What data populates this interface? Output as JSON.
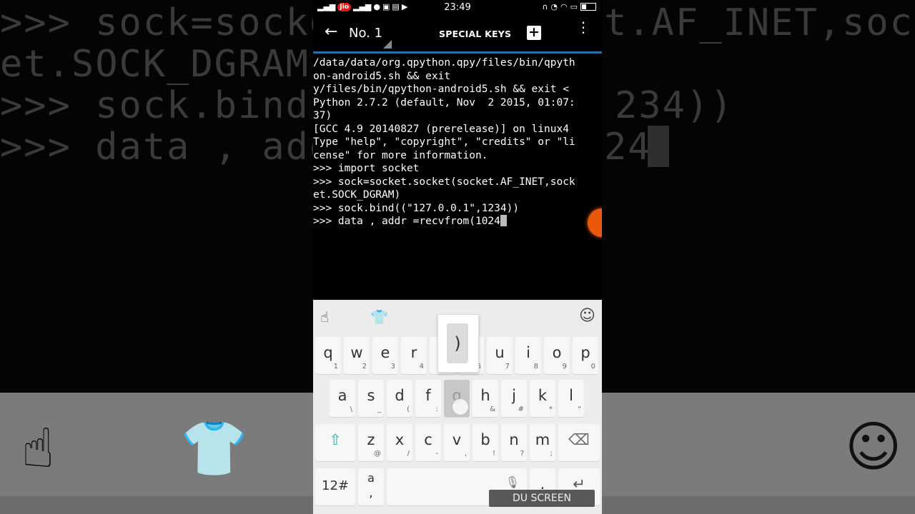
{
  "background": {
    "lines": [
      ">>> sock=socket",
      "et.SOCK_DGRAM)",
      ">>> sock.bind((",
      ">>> data , addr"
    ],
    "lines_right": [
      "t.AF_INET,sock",
      "",
      "234))",
      "24"
    ]
  },
  "status_bar": {
    "carrier": "Jio",
    "time": "23:49"
  },
  "app_bar": {
    "title": "No. 1",
    "special_keys": "SPECIAL KEYS"
  },
  "terminal": {
    "lines": [
      "/data/data/org.qpython.qpy/files/bin/qpyth",
      "on-android5.sh && exit",
      "y/files/bin/qpython-android5.sh && exit <",
      "Python 2.7.2 (default, Nov  2 2015, 01:07:",
      "37)",
      "[GCC 4.9 20140827 (prerelease)] on linux4",
      "Type \"help\", \"copyright\", \"credits\" or \"li",
      "cense\" for more information.",
      ">>> import socket",
      ">>> sock=socket.socket(socket.AF_INET,sock",
      "et.SOCK_DGRAM)",
      ">>> sock.bind((\"127.0.0.1\",1234))",
      ">>> data , addr =recvfrom(1024"
    ]
  },
  "keyboard": {
    "popup_char": ")",
    "row1": [
      {
        "k": "q",
        "s": "1"
      },
      {
        "k": "w",
        "s": "2"
      },
      {
        "k": "e",
        "s": "3"
      },
      {
        "k": "r",
        "s": "4"
      },
      {
        "k": "t",
        "s": "5"
      },
      {
        "k": "y",
        "s": "6"
      },
      {
        "k": "u",
        "s": "7"
      },
      {
        "k": "i",
        "s": "8"
      },
      {
        "k": "o",
        "s": "9"
      },
      {
        "k": "p",
        "s": "0"
      }
    ],
    "row2": [
      {
        "k": "a",
        "s": "\\"
      },
      {
        "k": "s",
        "s": "_"
      },
      {
        "k": "d",
        "s": "("
      },
      {
        "k": "f",
        "s": ":"
      },
      {
        "k": "g",
        "s": ")"
      },
      {
        "k": "h",
        "s": "&"
      },
      {
        "k": "j",
        "s": "#"
      },
      {
        "k": "k",
        "s": "*"
      },
      {
        "k": "l",
        "s": "\""
      }
    ],
    "row3": [
      {
        "k": "z",
        "s": "@"
      },
      {
        "k": "x",
        "s": "/"
      },
      {
        "k": "c",
        "s": "-"
      },
      {
        "k": "v",
        "s": ","
      },
      {
        "k": "b",
        "s": "!"
      },
      {
        "k": "n",
        "s": "?"
      },
      {
        "k": "m",
        "s": ";"
      }
    ],
    "symbols_key": "12#",
    "comma_key_top": "a",
    "comma_key_bottom": ","
  },
  "watermark": "DU SCREEN RECORDER"
}
